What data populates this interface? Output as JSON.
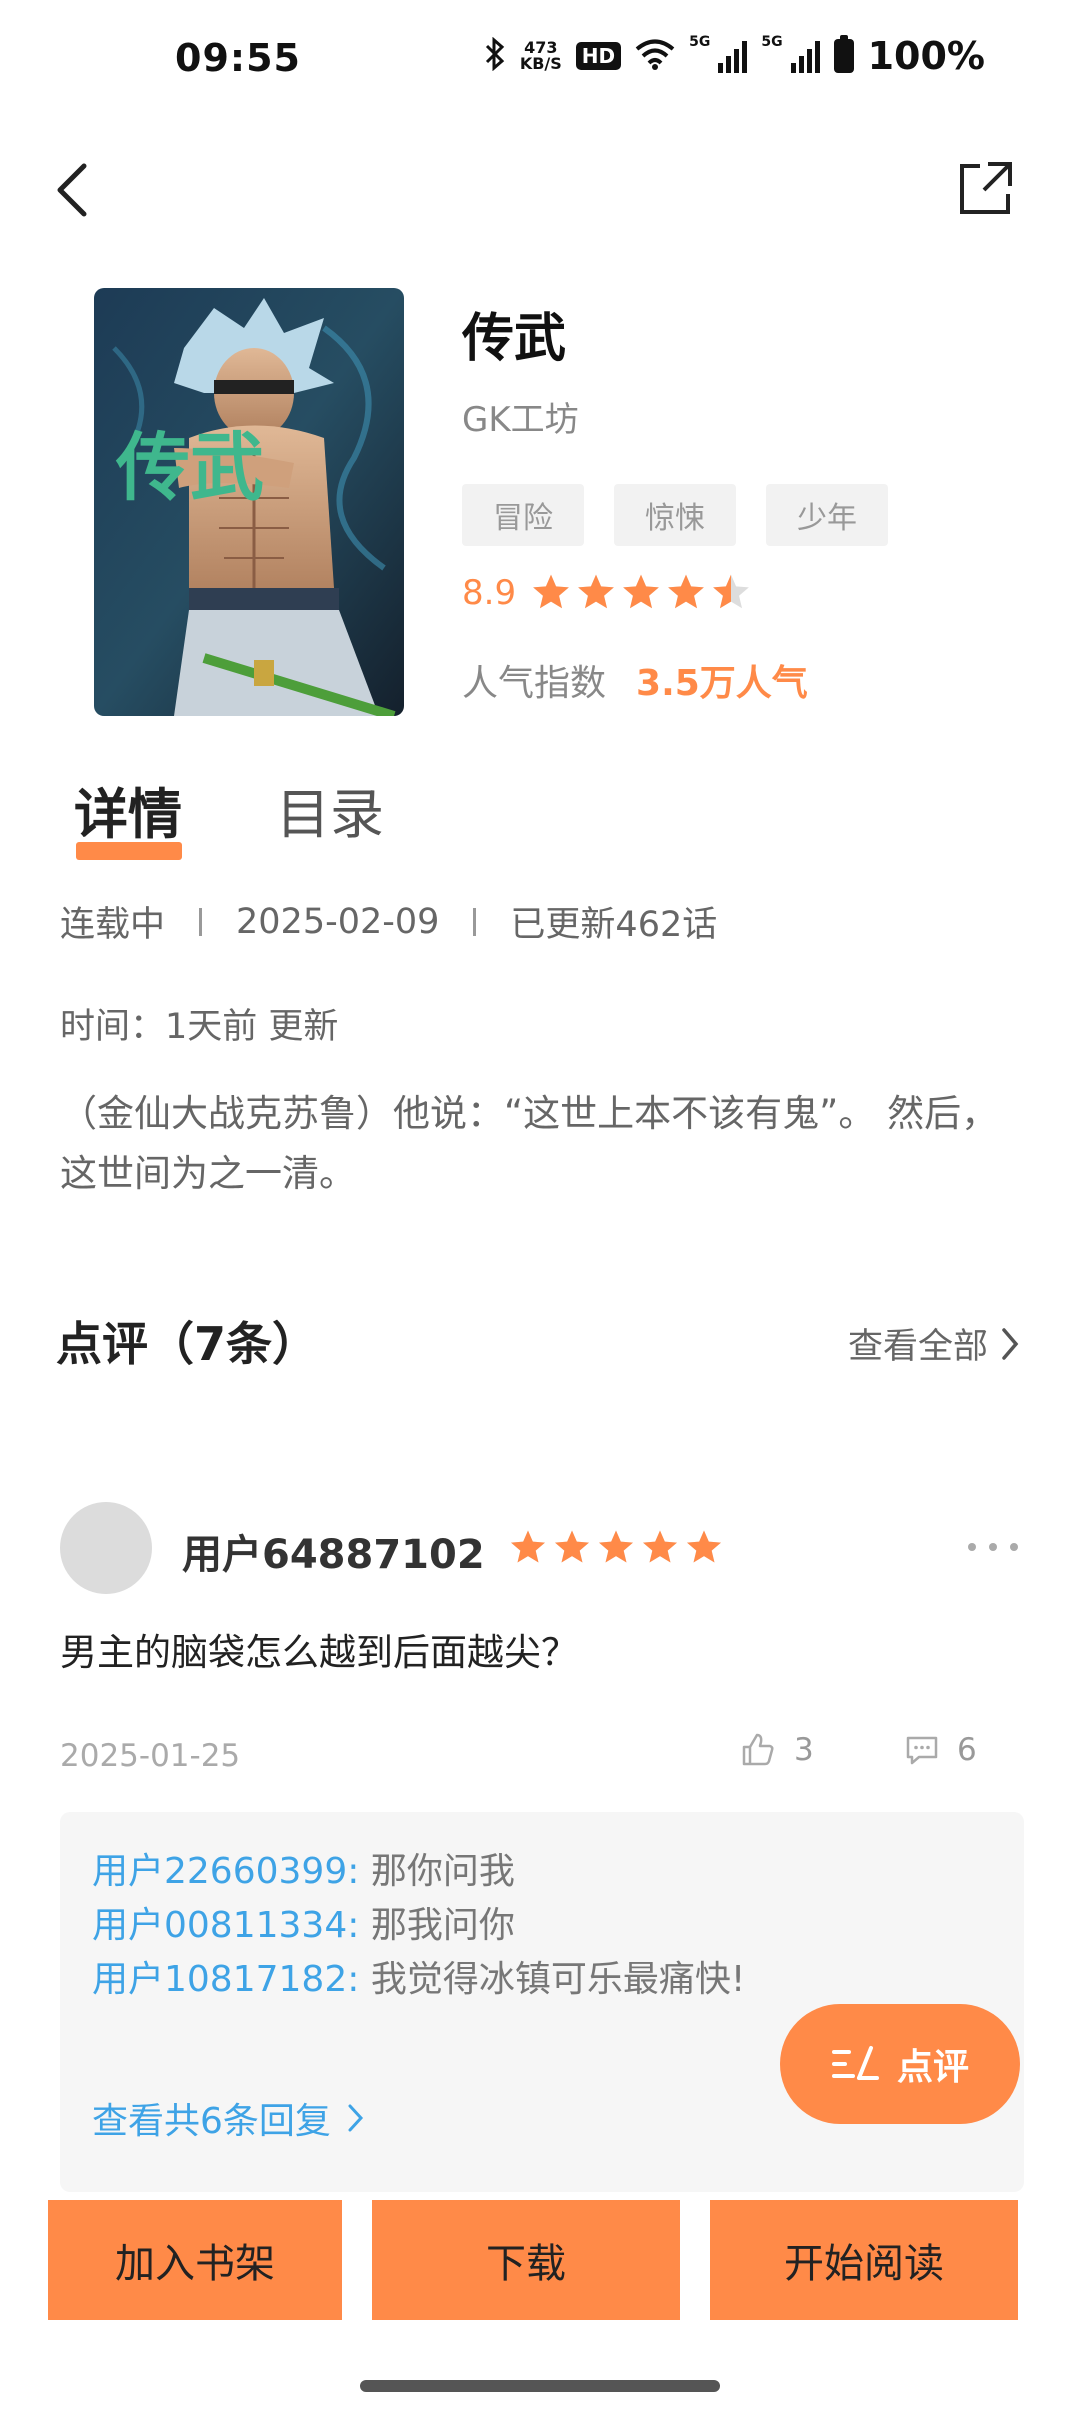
{
  "status_bar": {
    "time": "09:55",
    "network_speed_value": "473",
    "network_speed_unit": "KB/S",
    "hd_label": "HD",
    "signal_1": "5G",
    "signal_2": "5G",
    "battery": "100%",
    "icons": [
      "bluetooth-icon",
      "wifi-icon",
      "signal-icon",
      "battery-icon"
    ]
  },
  "nav": {
    "back_icon": "chevron-left-icon",
    "share_icon": "share-icon"
  },
  "book": {
    "title": "传武",
    "author": "GK工坊",
    "cover_text": "传武",
    "tags": [
      "冒险",
      "惊悚",
      "少年"
    ],
    "rating": "8.9",
    "stars": 4.5,
    "popularity_label": "人气指数",
    "popularity_value": "3.5万人气"
  },
  "tabs": [
    {
      "label": "详情",
      "active": true
    },
    {
      "label": "目录",
      "active": false
    }
  ],
  "details": {
    "status": "连载中",
    "date": "2025-02-09",
    "episodes": "已更新462话",
    "update_time": "时间：1天前 更新",
    "synopsis": "（金仙大战克苏鲁）他说：“这世上本不该有鬼”。 然后，这世间为之一清。"
  },
  "reviews": {
    "title": "点评（7条）",
    "see_all": "查看全部",
    "items": [
      {
        "user": "用户64887102",
        "stars": 5,
        "text": "男主的脑袋怎么越到后面越尖？",
        "date": "2025-01-25",
        "likes": "3",
        "comments": "6",
        "replies": [
          {
            "user": "用户22660399:",
            "text": " 那你问我"
          },
          {
            "user": "用户00811334:",
            "text": " 那我问你"
          },
          {
            "user": "用户10817182:",
            "text": " 我觉得冰镇可乐最痛快!"
          }
        ],
        "view_replies": "查看共6条回复"
      }
    ]
  },
  "fab": {
    "label": "点评"
  },
  "bottom": {
    "add_shelf": "加入书架",
    "download": "下载",
    "start_read": "开始阅读"
  },
  "colors": {
    "accent": "#ff8a48",
    "link": "#3ea3e6",
    "tag_bg": "#f2f2f2",
    "reply_bg": "#f6f6f6"
  }
}
